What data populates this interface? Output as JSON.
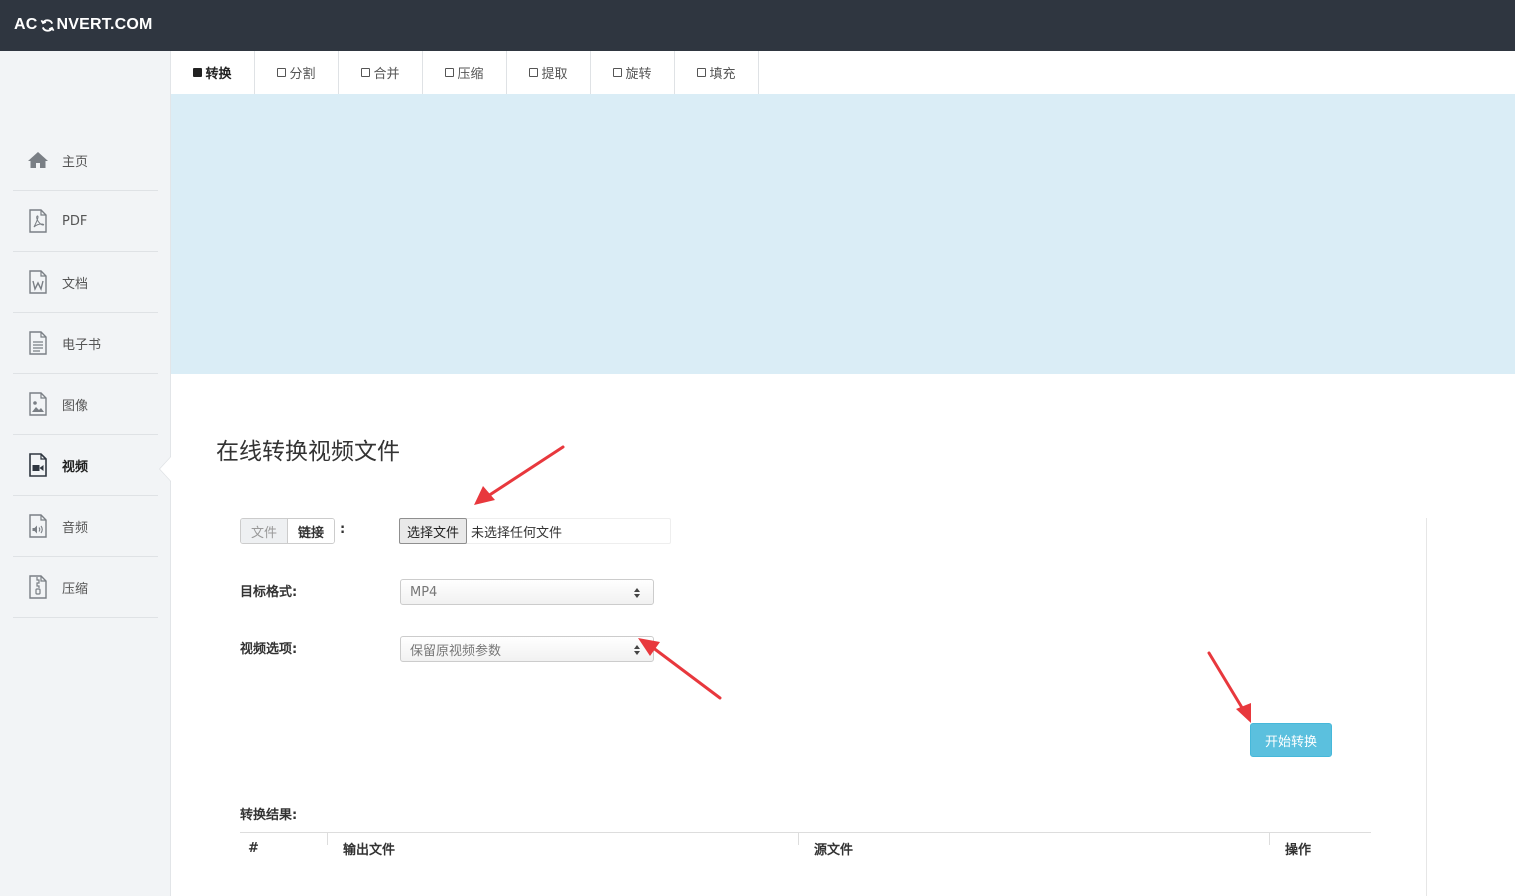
{
  "header": {
    "logo_left": "AC",
    "logo_right": "NVERT.COM"
  },
  "sidebar": {
    "items": [
      {
        "label": "主页",
        "icon": "home-icon"
      },
      {
        "label": "PDF",
        "icon": "pdf-file-icon"
      },
      {
        "label": "文档",
        "icon": "word-file-icon"
      },
      {
        "label": "电子书",
        "icon": "ebook-file-icon"
      },
      {
        "label": "图像",
        "icon": "image-file-icon"
      },
      {
        "label": "视频",
        "icon": "video-file-icon",
        "active": true
      },
      {
        "label": "音频",
        "icon": "audio-file-icon"
      },
      {
        "label": "压缩",
        "icon": "archive-file-icon"
      }
    ]
  },
  "tabs": [
    {
      "label": "转换",
      "active": true
    },
    {
      "label": "分割"
    },
    {
      "label": "合并"
    },
    {
      "label": "压缩"
    },
    {
      "label": "提取"
    },
    {
      "label": "旋转"
    },
    {
      "label": "填充"
    }
  ],
  "main": {
    "title": "在线转换视频文件",
    "source_toggle": {
      "file": "文件",
      "link": "链接",
      "colon": ":"
    },
    "file_input": {
      "button": "选择文件",
      "status": "未选择任何文件"
    },
    "target_format": {
      "label": "目标格式:",
      "value": "MP4"
    },
    "video_options": {
      "label": "视频选项:",
      "value": "保留原视频参数"
    },
    "convert_button": "开始转换",
    "results": {
      "label": "转换结果:",
      "columns": [
        "#",
        "输出文件",
        "源文件",
        "操作"
      ]
    }
  },
  "colors": {
    "topbar": "#2f3640",
    "banner": "#daedf6",
    "primary_button": "#5bc0de",
    "annotation_arrow": "#e8383d"
  }
}
